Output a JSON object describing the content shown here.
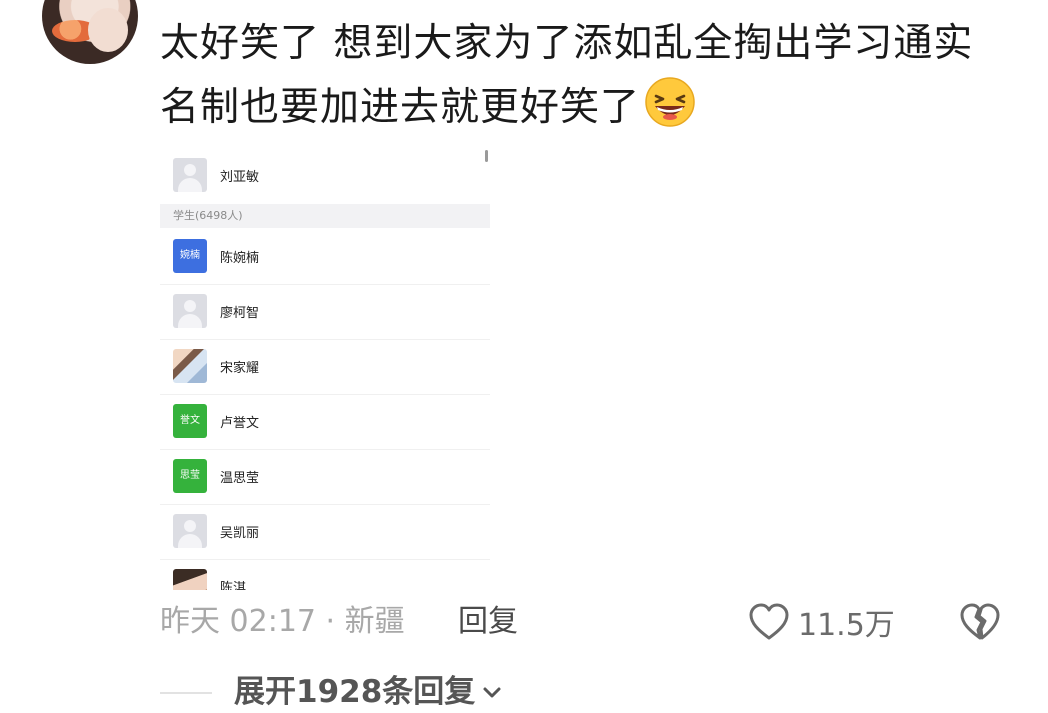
{
  "comment": {
    "text": "太好笑了 想到大家为了添如乱全掏出学习通实名制也要加进去就更好笑了",
    "emoji": "grinning-squinting-face"
  },
  "screenshot": {
    "section_label": "学生(6498人)",
    "top_member": "刘亚敏",
    "members": [
      {
        "name": "陈婉楠",
        "avatar_text": "婉楠",
        "avatar_color": "#3d6fe0"
      },
      {
        "name": "廖柯智",
        "avatar_text": ""
      },
      {
        "name": "宋家耀",
        "avatar_text": ""
      },
      {
        "name": "卢誉文",
        "avatar_text": "誉文",
        "avatar_color": "#35b23c"
      },
      {
        "name": "温思莹",
        "avatar_text": "思莹",
        "avatar_color": "#35b23c"
      },
      {
        "name": "吴凯丽",
        "avatar_text": ""
      },
      {
        "name": "陈淇",
        "avatar_text": ""
      }
    ]
  },
  "meta": {
    "time_location": "昨天 02:17 · 新疆",
    "reply_label": "回复",
    "like_count": "11.5万"
  },
  "expand": {
    "label": "展开1928条回复"
  }
}
